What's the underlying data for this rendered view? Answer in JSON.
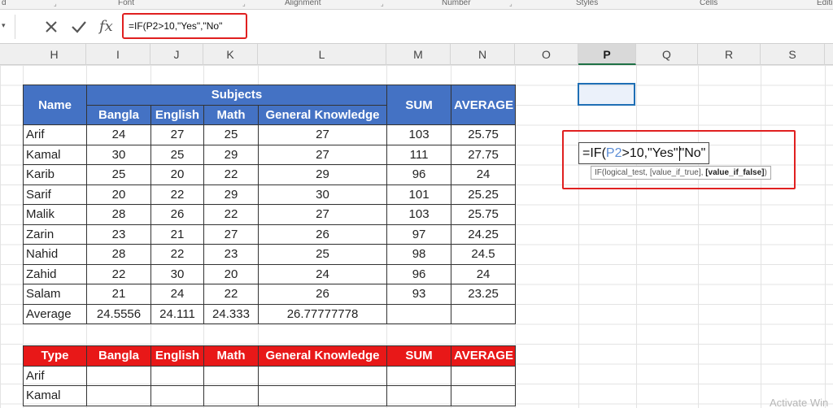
{
  "ribbon": {
    "groups": [
      "d",
      "Font",
      "Alignment",
      "Number",
      "Styles",
      "Cells",
      "Editi"
    ]
  },
  "formula_bar": {
    "name_box_arrow": "▾",
    "fx": "fx",
    "formula": "=IF(P2>10,\"Yes\",\"No\""
  },
  "columns": [
    "H",
    "I",
    "J",
    "K",
    "L",
    "M",
    "N",
    "O",
    "P",
    "Q",
    "R",
    "S"
  ],
  "selected_column": "P",
  "table1": {
    "header_name": "Name",
    "header_subjects": "Subjects",
    "header_sum": "SUM",
    "header_average": "AVERAGE",
    "subjects": [
      "Bangla",
      "English",
      "Math",
      "General Knowledge"
    ],
    "rows": [
      {
        "name": "Arif",
        "bangla": "24",
        "english": "27",
        "math": "25",
        "gk": "27",
        "sum": "103",
        "avg": "25.75"
      },
      {
        "name": "Kamal",
        "bangla": "30",
        "english": "25",
        "math": "29",
        "gk": "27",
        "sum": "111",
        "avg": "27.75"
      },
      {
        "name": "Karib",
        "bangla": "25",
        "english": "20",
        "math": "22",
        "gk": "29",
        "sum": "96",
        "avg": "24"
      },
      {
        "name": "Sarif",
        "bangla": "20",
        "english": "22",
        "math": "29",
        "gk": "30",
        "sum": "101",
        "avg": "25.25"
      },
      {
        "name": "Malik",
        "bangla": "28",
        "english": "26",
        "math": "22",
        "gk": "27",
        "sum": "103",
        "avg": "25.75"
      },
      {
        "name": "Zarin",
        "bangla": "23",
        "english": "21",
        "math": "27",
        "gk": "26",
        "sum": "97",
        "avg": "24.25"
      },
      {
        "name": "Nahid",
        "bangla": "28",
        "english": "22",
        "math": "23",
        "gk": "25",
        "sum": "98",
        "avg": "24.5"
      },
      {
        "name": "Zahid",
        "bangla": "22",
        "english": "30",
        "math": "20",
        "gk": "24",
        "sum": "96",
        "avg": "24"
      },
      {
        "name": "Salam",
        "bangla": "21",
        "english": "24",
        "math": "22",
        "gk": "26",
        "sum": "93",
        "avg": "23.25"
      }
    ],
    "average_row": {
      "label": "Average",
      "bangla": "24.5556",
      "english": "24.111",
      "math": "24.333",
      "gk": "26.77777778"
    }
  },
  "table2": {
    "headers": [
      "Type",
      "Bangla",
      "English",
      "Math",
      "General Knowledge",
      "SUM",
      "AVERAGE"
    ],
    "rows": [
      "Arif",
      "Kamal"
    ]
  },
  "editing_cell": {
    "prefix": "=IF(",
    "ref": "P2",
    "suffix_a": ">10,\"Yes\"",
    "suffix_b": "\"No\""
  },
  "tooltip": {
    "fn": "IF(",
    "arg1": "logical_test",
    "arg2": "[value_if_true]",
    "arg3": "[value_if_false]",
    "close": ")"
  },
  "watermark": "Activate Win",
  "colors": {
    "header_blue": "#4472c4",
    "header_red": "#e81818",
    "highlight_red": "#e02020",
    "selection_blue": "#1f6fb5"
  }
}
